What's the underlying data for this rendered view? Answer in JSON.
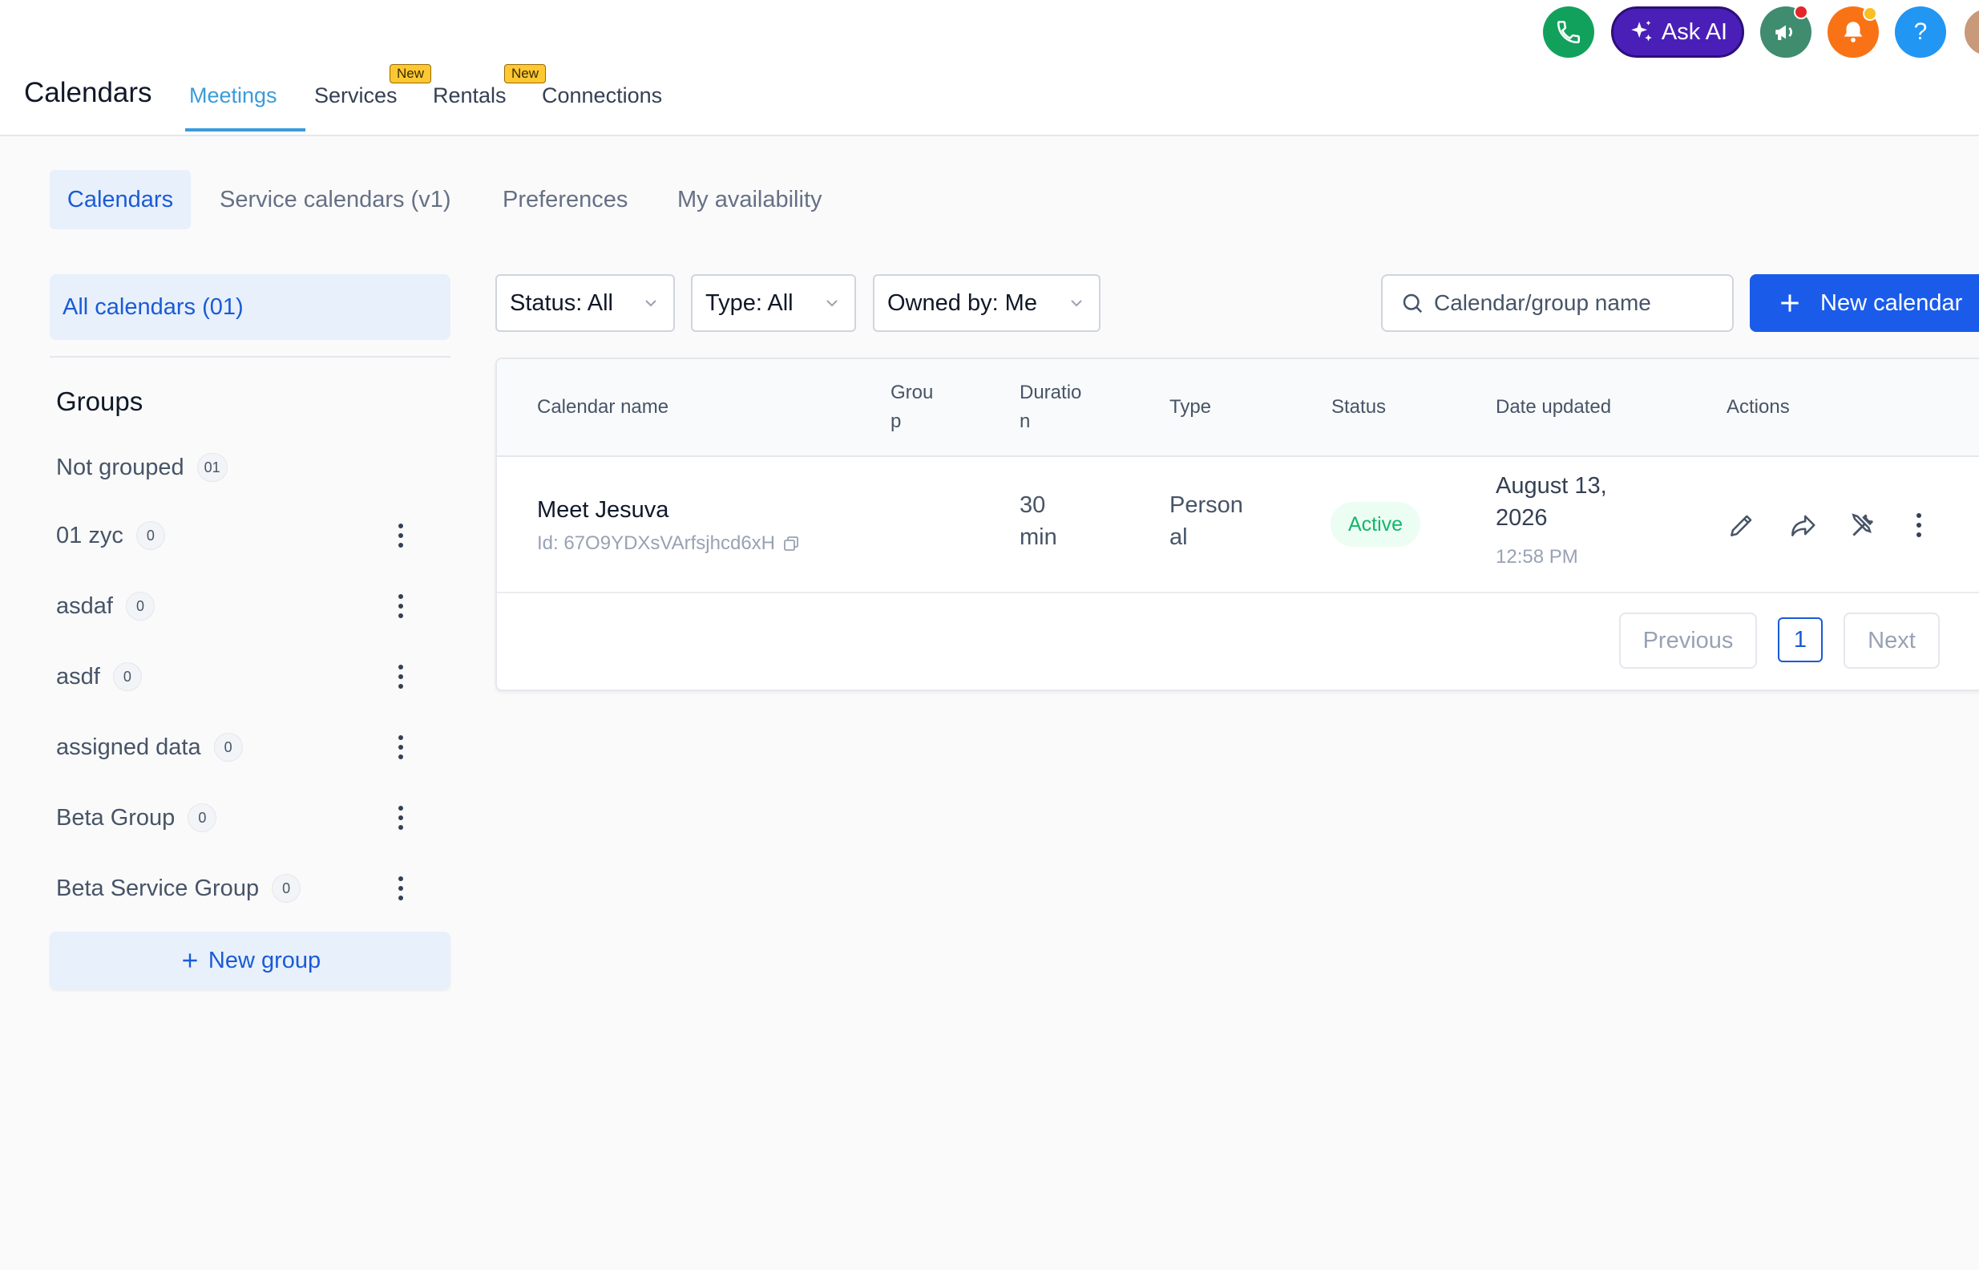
{
  "header": {
    "app_title": "Calendars",
    "tabs": [
      {
        "label": "Meetings",
        "active": true
      },
      {
        "label": "Services",
        "badge": "New"
      },
      {
        "label": "Rentals",
        "badge": "New"
      },
      {
        "label": "Connections"
      }
    ],
    "ask_ai_label": "Ask AI",
    "help_label": "?",
    "icons": [
      "phone-icon",
      "sparkles-icon",
      "megaphone-icon",
      "bell-icon",
      "help-icon",
      "avatar"
    ]
  },
  "subtabs": [
    {
      "label": "Calendars",
      "active": true
    },
    {
      "label": "Service calendars (v1)"
    },
    {
      "label": "Preferences"
    },
    {
      "label": "My availability"
    }
  ],
  "sidebar": {
    "all_calendars": "All calendars (01)",
    "groups_title": "Groups",
    "groups": [
      {
        "name": "Not grouped",
        "count": "01"
      },
      {
        "name": "01 zyc",
        "count": "0"
      },
      {
        "name": "asdaf",
        "count": "0"
      },
      {
        "name": "asdf",
        "count": "0"
      },
      {
        "name": "assigned data",
        "count": "0"
      },
      {
        "name": "Beta Group",
        "count": "0"
      },
      {
        "name": "Beta Service Group",
        "count": "0"
      }
    ],
    "new_group": "New group"
  },
  "filters": {
    "status": "Status: All",
    "type": "Type: All",
    "owned_by": "Owned by: Me",
    "search_placeholder": "Calendar/group name",
    "new_calendar": "New calendar"
  },
  "table": {
    "columns": {
      "name": "Calendar name",
      "group_1": "Grou",
      "group_2": "p",
      "duration_1": "Duratio",
      "duration_2": "n",
      "type": "Type",
      "status": "Status",
      "date_updated": "Date updated",
      "actions": "Actions"
    },
    "rows": [
      {
        "name": "Meet Jesuva",
        "id": "Id: 67O9YDXsVArfsjhcd6xH",
        "duration_1": "30",
        "duration_2": "min",
        "type_1": "Person",
        "type_2": "al",
        "status": "Active",
        "date_1": "August 13,",
        "date_2": "2026",
        "time": "12:58 PM"
      }
    ]
  },
  "pagination": {
    "previous": "Previous",
    "page": "1",
    "next": "Next"
  },
  "colors": {
    "primary": "#1a5bea",
    "tab_active": "#3b9bd9",
    "status_active": "#12b76a",
    "ask_ai": "#4a1fb8"
  }
}
